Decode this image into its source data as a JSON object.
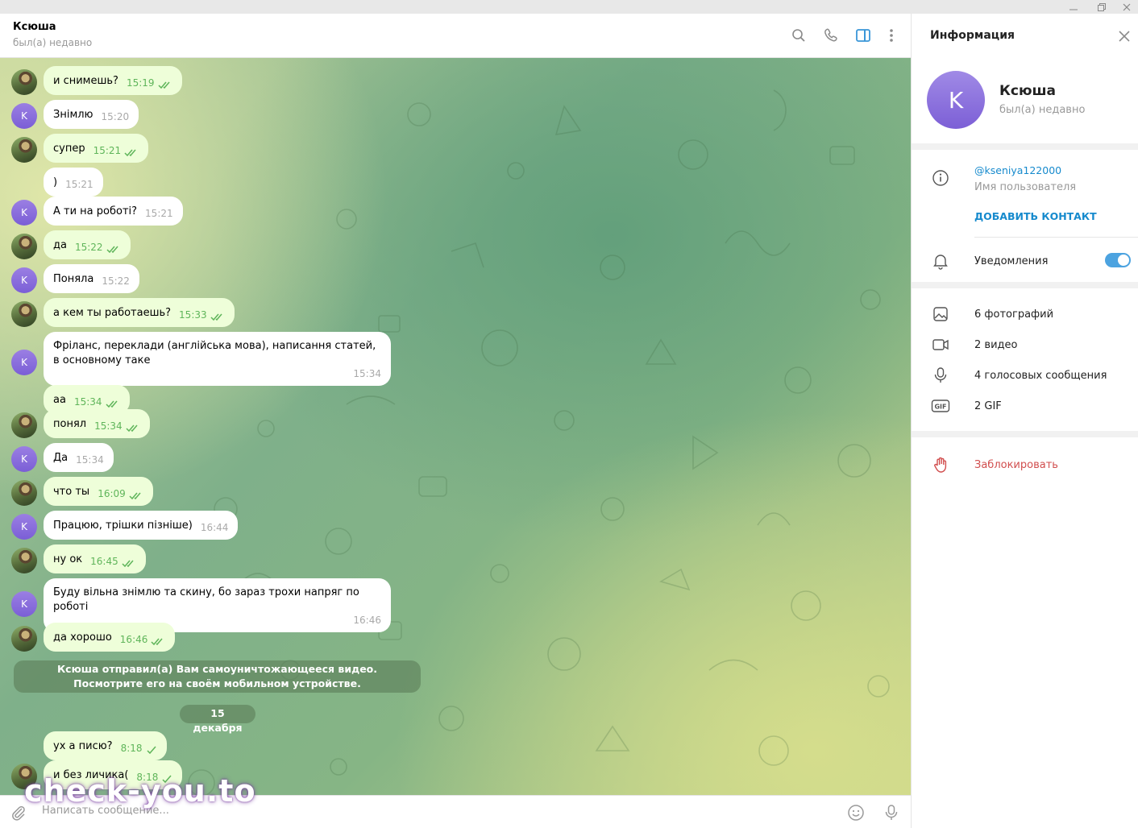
{
  "header": {
    "chat_name": "Ксюша",
    "chat_status": "был(а) недавно"
  },
  "messages": [
    {
      "side": "out",
      "text": "и снимешь?",
      "time": "15:19",
      "read": true
    },
    {
      "side": "in",
      "text": "Знімлю",
      "time": "15:20"
    },
    {
      "side": "out",
      "text": "супер",
      "time": "15:21",
      "read": true
    },
    {
      "side": "in",
      "text": ")",
      "time": "15:21"
    },
    {
      "side": "in",
      "text": "А ти на роботі?",
      "time": "15:21"
    },
    {
      "side": "out",
      "text": "да",
      "time": "15:22",
      "read": true
    },
    {
      "side": "in",
      "text": "Поняла",
      "time": "15:22"
    },
    {
      "side": "out",
      "text": "а кем ты работаешь?",
      "time": "15:33",
      "read": true
    },
    {
      "side": "in",
      "text": "Фріланс, переклади (англійська мова), написання статей, в основному таке",
      "time": "15:34"
    },
    {
      "side": "out",
      "text": "аа",
      "time": "15:34",
      "read": true
    },
    {
      "side": "out",
      "text": "понял",
      "time": "15:34",
      "read": true
    },
    {
      "side": "in",
      "text": "Да",
      "time": "15:34"
    },
    {
      "side": "out",
      "text": "что ты",
      "time": "16:09",
      "read": true
    },
    {
      "side": "in",
      "text": "Працюю, трішки пізніше)",
      "time": "16:44"
    },
    {
      "side": "out",
      "text": "ну ок",
      "time": "16:45",
      "read": true
    },
    {
      "side": "in",
      "text": "Буду вільна знімлю та скину, бо зараз трохи напряг по роботі",
      "time": "16:46"
    },
    {
      "side": "out",
      "text": "да хорошо",
      "time": "16:46",
      "read": true
    },
    {
      "side": "out",
      "text": "ух а писю?",
      "time": "8:18",
      "read": false
    },
    {
      "side": "out",
      "text": "и без личика(",
      "time": "8:18",
      "read": false
    }
  ],
  "service_message": "Ксюша отправил(а) Вам самоуничтожающееся видео. Посмотрите его на своём мобильном устройстве.",
  "date_separator": "15 декабря",
  "composer": {
    "placeholder": "Написать сообщение..."
  },
  "watermark": "check-you.to",
  "avatar_letter": "K",
  "info": {
    "title": "Информация",
    "avatar_letter": "K",
    "name": "Ксюша",
    "status": "был(а) недавно",
    "username": "@kseniya122000",
    "username_caption": "Имя пользователя",
    "add_contact": "ДОБАВИТЬ КОНТАКТ",
    "notifications_label": "Уведомления",
    "notifications_on": true,
    "media": [
      {
        "icon": "photo-icon",
        "label": "6 фотографий"
      },
      {
        "icon": "video-icon",
        "label": "2 видео"
      },
      {
        "icon": "microphone-icon",
        "label": "4 голосовых сообщения"
      },
      {
        "icon": "gif-icon",
        "label": "2 GIF"
      }
    ],
    "block_label": "Заблокировать"
  },
  "colors": {
    "accent": "#168acd",
    "outgoing_bubble": "#eefed9",
    "incoming_bubble": "#ffffff",
    "read_check": "#5fb55a",
    "danger": "#d14e4e",
    "avatar_purple": "#8a6ddf"
  }
}
